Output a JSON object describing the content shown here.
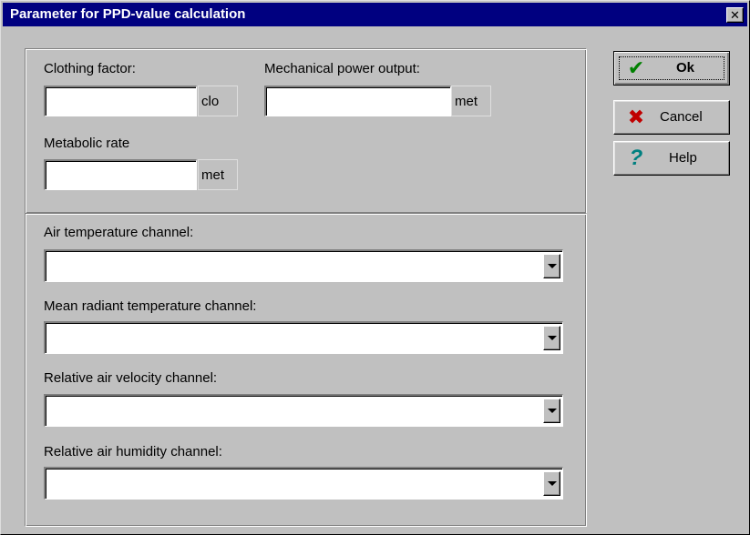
{
  "window": {
    "title": "Parameter for PPD-value calculation",
    "close_glyph": "✕"
  },
  "fields": {
    "clothing_factor": {
      "label": "Clothing factor:",
      "value": "",
      "unit": "clo"
    },
    "mechanical_power": {
      "label": "Mechanical power output:",
      "value": "",
      "unit": "met"
    },
    "metabolic_rate": {
      "label": "Metabolic rate",
      "value": "",
      "unit": "met"
    }
  },
  "channels": [
    {
      "label": "Air temperature channel:",
      "value": ""
    },
    {
      "label": "Mean radiant temperature channel:",
      "value": ""
    },
    {
      "label": "Relative air velocity channel:",
      "value": ""
    },
    {
      "label": "Relative air humidity channel:",
      "value": ""
    }
  ],
  "buttons": {
    "ok": {
      "label": "Ok",
      "icon": "check-icon",
      "glyph": "✔",
      "color": "#008000"
    },
    "cancel": {
      "label": "Cancel",
      "icon": "x-icon",
      "glyph": "✖",
      "color": "#c00000"
    },
    "help": {
      "label": "Help",
      "icon": "question-icon",
      "glyph": "?",
      "color": "#008080"
    }
  }
}
